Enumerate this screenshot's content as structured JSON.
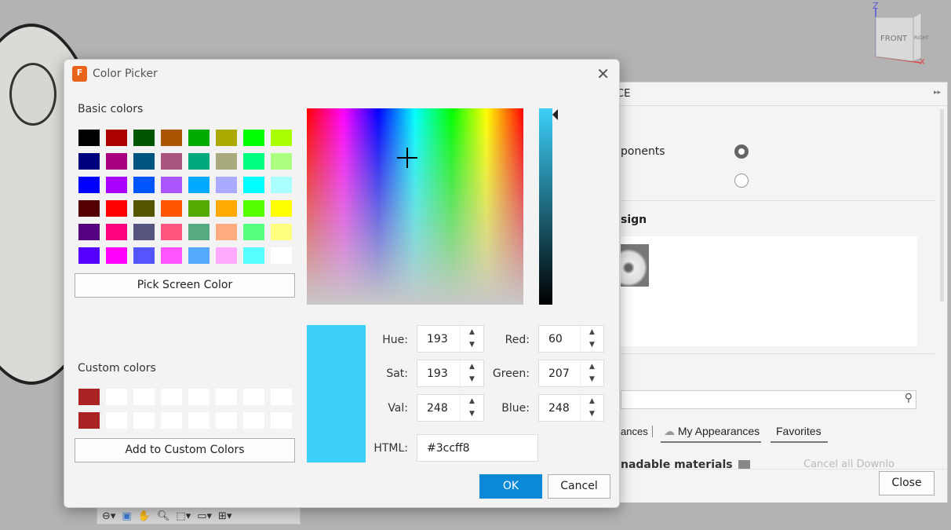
{
  "background": {
    "viewcube_front": "FRONT",
    "viewcube_right": "RIGHT",
    "axis_z": "Z",
    "axis_x": "X"
  },
  "panel": {
    "header": "CE",
    "expand_icon": "double-chevron-right",
    "option_components": "ponents",
    "section_design": "sign",
    "tab_appearances": "ances",
    "tab_my_appearances": "My Appearances",
    "tab_favorites": "Favorites",
    "downloadable_materials": "nadable materials",
    "cancel_downloads": "Cancel all Downlo",
    "close": "Close"
  },
  "dialog": {
    "title": "Color Picker",
    "basic_colors_label": "Basic colors",
    "basic_colors": [
      [
        "#000000",
        "#aa0000",
        "#005500",
        "#aa5500",
        "#00aa00",
        "#aaaa00",
        "#00ff00",
        "#aaff00"
      ],
      [
        "#00007f",
        "#aa007f",
        "#00557f",
        "#aa557f",
        "#00aa7f",
        "#aaaa7f",
        "#00ff7f",
        "#aaff7f"
      ],
      [
        "#0000ff",
        "#aa00ff",
        "#0055ff",
        "#aa55ff",
        "#00aaff",
        "#aaaaff",
        "#00ffff",
        "#aaffff"
      ],
      [
        "#550000",
        "#ff0000",
        "#555500",
        "#ff5500",
        "#55aa00",
        "#ffaa00",
        "#55ff00",
        "#ffff00"
      ],
      [
        "#55007f",
        "#ff007f",
        "#55557f",
        "#ff557f",
        "#55aa7f",
        "#ffaa7f",
        "#55ff7f",
        "#ffff7f"
      ],
      [
        "#5500ff",
        "#ff00ff",
        "#5555ff",
        "#ff55ff",
        "#55aaff",
        "#ffaaff",
        "#55ffff",
        "#ffffff"
      ]
    ],
    "pick_screen_color": "Pick Screen Color",
    "custom_colors_label": "Custom colors",
    "custom_colors": [
      [
        "#aa2222",
        "#ffffff",
        "#ffffff",
        "#ffffff",
        "#ffffff",
        "#ffffff",
        "#ffffff",
        "#ffffff"
      ],
      [
        "#aa2222",
        "#ffffff",
        "#ffffff",
        "#ffffff",
        "#ffffff",
        "#ffffff",
        "#ffffff",
        "#ffffff"
      ]
    ],
    "add_custom": "Add to Custom Colors",
    "current_color": "#3ccff8",
    "fields": {
      "hue_label": "Hue:",
      "hue": "193",
      "sat_label": "Sat:",
      "sat": "193",
      "val_label": "Val:",
      "val": "248",
      "red_label": "Red:",
      "red": "60",
      "green_label": "Green:",
      "green": "207",
      "blue_label": "Blue:",
      "blue": "248",
      "html_label": "HTML:",
      "html": "#3ccff8"
    },
    "ok": "OK",
    "cancel": "Cancel"
  },
  "toolbar": {
    "icons": [
      "orbit",
      "look-at",
      "pan",
      "zoom",
      "fit",
      "display",
      "grid"
    ]
  }
}
